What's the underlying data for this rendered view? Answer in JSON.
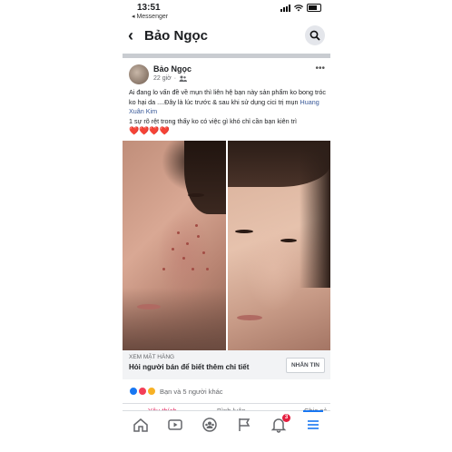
{
  "status": {
    "time": "13:51",
    "back_app": "◂ Messenger"
  },
  "nav": {
    "title": "Bảo Ngọc"
  },
  "post": {
    "author": "Bảo Ngọc",
    "time": "22 giờ",
    "line1": "Ai đang lo vấn đề về mụn thì liên hệ bạn này sản phẩm ko bong tróc ko hại da ....Đây là lúc trước & sau khi sử dụng cici trị mụn ",
    "tag": "Huang Xuân Kim",
    "line2": "1 sự rõ rệt trong thấy ko có việc gì khó chỉ cần bạn kiên trì",
    "hearts": "❤️❤️❤️❤️"
  },
  "cta": {
    "label_small": "XEM MẶT HÀNG",
    "label_main": "Hỏi người bán để biết thêm chi tiết",
    "button": "NHẮN TIN"
  },
  "reactions": {
    "text": "Bạn và 5 người khác"
  },
  "actions": {
    "like": "Yêu thích",
    "comment": "Bình luận",
    "share": "Chia sẻ"
  },
  "tabs": {
    "notifications_badge": "3"
  },
  "colors": {
    "accent": "#1877f2",
    "love": "#e0245e",
    "badge": "#e41e3f"
  }
}
